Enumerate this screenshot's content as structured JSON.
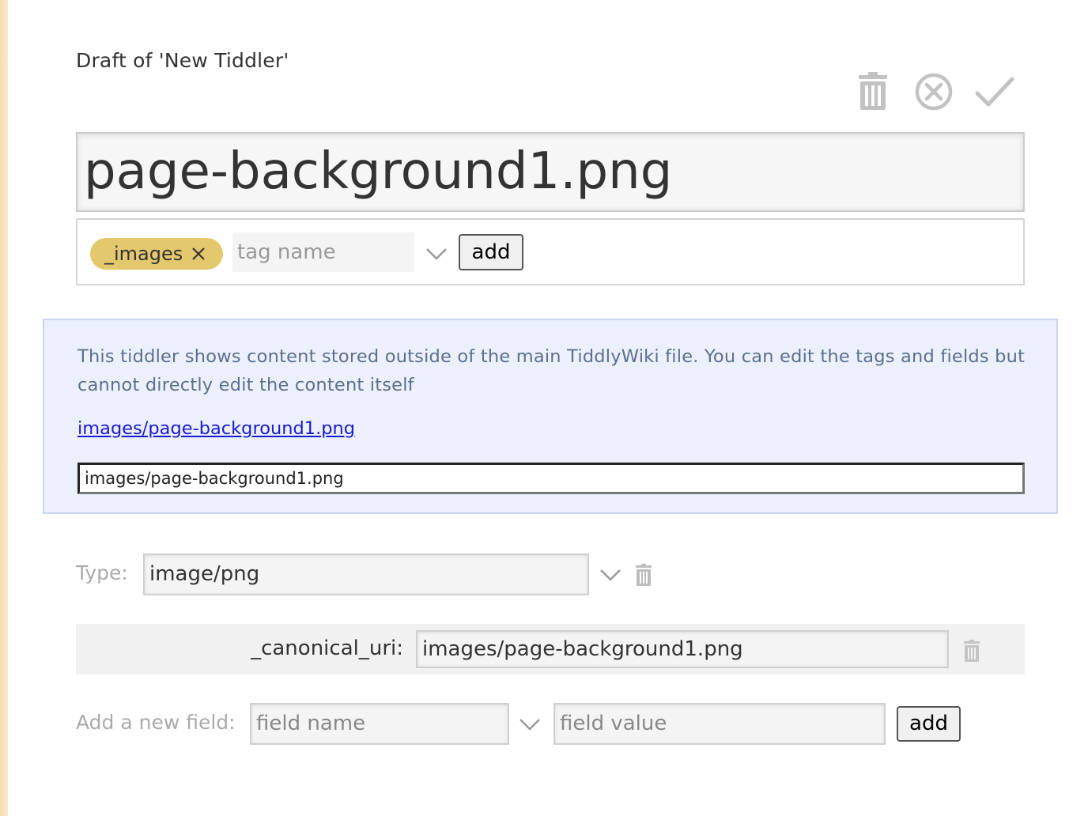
{
  "colors": {
    "accent_tag": "#e4c86e",
    "info_background": "#ebf0fc",
    "info_text": "#5d6f8f",
    "link": "#1a1ad6",
    "left_strip": "#f5deb3"
  },
  "header": {
    "subtitle": "Draft of 'New Tiddler'",
    "toolbar": {
      "buttons": [
        {
          "name": "delete",
          "icon": "trash-icon"
        },
        {
          "name": "cancel",
          "icon": "close-circle-icon"
        },
        {
          "name": "save",
          "icon": "checkmark-icon"
        }
      ]
    }
  },
  "editor": {
    "title_value": "page-background1.png",
    "tags": {
      "items": [
        {
          "label": "_images",
          "remove_icon": "close-icon"
        }
      ],
      "input_placeholder": "tag name",
      "dropdown_icon": "chevron-down-icon",
      "add_label": "add"
    },
    "external_notice": {
      "message": "This tiddler shows content stored outside of the main TiddlyWiki file. You can edit the tags and fields but cannot directly edit the content itself",
      "link_text": "images/page-background1.png",
      "uri_value": "images/page-background1.png"
    },
    "type": {
      "label": "Type:",
      "value": "image/png",
      "dropdown_icon": "chevron-down-icon",
      "delete_icon": "trash-icon"
    },
    "fields": [
      {
        "name": "_canonical_uri:",
        "value": "images/page-background1.png",
        "delete_icon": "trash-icon"
      }
    ],
    "new_field": {
      "label": "Add a new field:",
      "name_placeholder": "field name",
      "value_placeholder": "field value",
      "dropdown_icon": "chevron-down-icon",
      "add_label": "add"
    }
  }
}
